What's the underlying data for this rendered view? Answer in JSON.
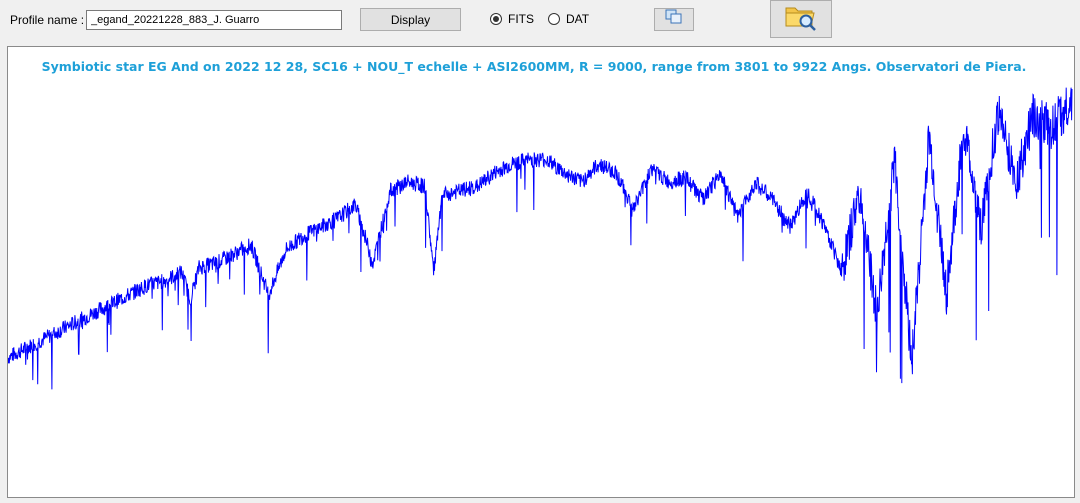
{
  "toolbar": {
    "profile_label": "Profile name :",
    "profile_value": "_egand_20221228_883_J. Guarro",
    "display_label": "Display",
    "fits_label": "FITS",
    "dat_label": "DAT",
    "format_selected": "FITS",
    "copy_icon": "copy-icon",
    "folder_icon": "folder-search-icon"
  },
  "plot": {
    "title": "Symbiotic star EG And on 2022 12 28,  SC16 + NOU_T echelle + ASI2600MM, R = 9000, range from 3801 to 9922 Angs. Observatori de Piera.",
    "line_color": "#0000ff",
    "title_color": "#1ea0d8"
  },
  "chart_data": {
    "type": "line",
    "title": "Symbiotic star EG And on 2022 12 28,  SC16 + NOU_T echelle + ASI2600MM, R = 9000, range from 3801 to 9922 Angs. Observatori de Piera.",
    "xlabel": "",
    "ylabel": "",
    "xlim": [
      3801,
      9922
    ],
    "ylim": [
      0,
      1
    ],
    "grid": false,
    "series": [
      {
        "x": [
          3801,
          3900,
          4000,
          4100,
          4200,
          4300,
          4400,
          4500,
          4600,
          4700,
          4800,
          4850,
          4900,
          5000,
          5100,
          5200,
          5300,
          5400,
          5500,
          5600,
          5700,
          5800,
          5900,
          6000,
          6100,
          6200,
          6250,
          6300,
          6400,
          6500,
          6600,
          6700,
          6800,
          6900,
          7000,
          7100,
          7200,
          7300,
          7400,
          7500,
          7600,
          7700,
          7800,
          7900,
          8000,
          8100,
          8200,
          8300,
          8400,
          8500,
          8600,
          8700,
          8800,
          8900,
          9000,
          9100,
          9200,
          9300,
          9400,
          9500,
          9600,
          9700,
          9800,
          9922
        ],
        "y": [
          0.31,
          0.33,
          0.35,
          0.37,
          0.39,
          0.41,
          0.43,
          0.45,
          0.47,
          0.48,
          0.5,
          0.44,
          0.51,
          0.52,
          0.54,
          0.56,
          0.45,
          0.55,
          0.58,
          0.6,
          0.62,
          0.65,
          0.52,
          0.68,
          0.7,
          0.69,
          0.5,
          0.67,
          0.68,
          0.69,
          0.72,
          0.74,
          0.75,
          0.75,
          0.72,
          0.7,
          0.74,
          0.72,
          0.64,
          0.73,
          0.7,
          0.71,
          0.66,
          0.72,
          0.62,
          0.7,
          0.66,
          0.6,
          0.68,
          0.6,
          0.5,
          0.68,
          0.4,
          0.75,
          0.3,
          0.8,
          0.45,
          0.82,
          0.6,
          0.86,
          0.7,
          0.85,
          0.82,
          0.88
        ]
      }
    ]
  }
}
